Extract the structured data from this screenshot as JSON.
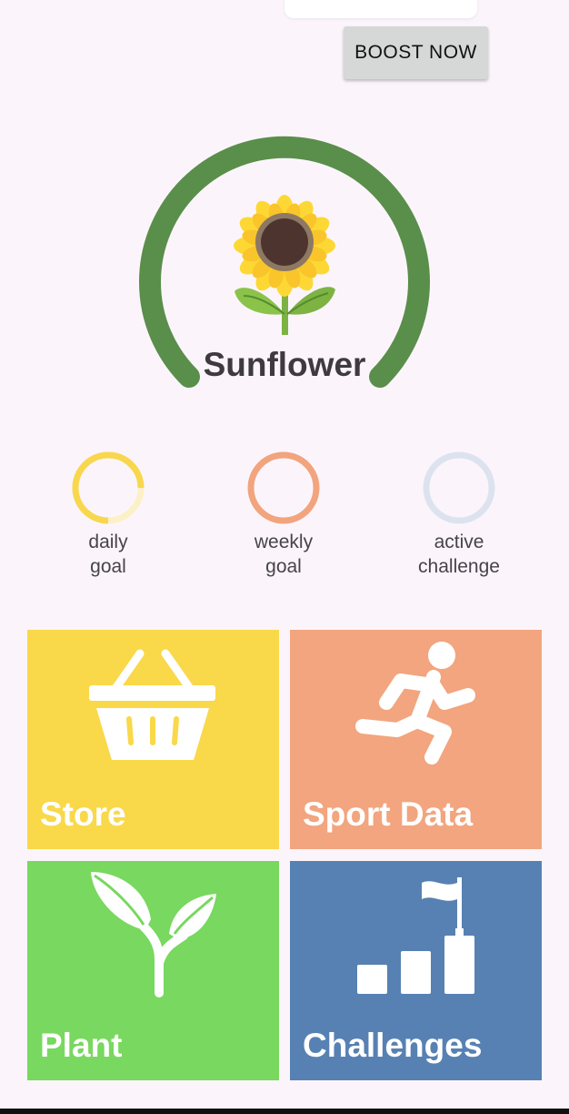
{
  "boost_button": {
    "label": "BOOST NOW"
  },
  "plant": {
    "name": "Sunflower",
    "icon": "sunflower-icon"
  },
  "goals": [
    {
      "label_line1": "daily",
      "label_line2": "goal",
      "color": "#F8D74E",
      "progress": 0.6
    },
    {
      "label_line1": "weekly",
      "label_line2": "goal",
      "color": "#F2A47E",
      "progress": 1.0
    },
    {
      "label_line1": "active",
      "label_line2": "challenge",
      "color": "#DCE3EF",
      "progress": 1.0
    }
  ],
  "tiles": [
    {
      "label": "Store",
      "color": "#F9D84A",
      "icon": "basket-icon"
    },
    {
      "label": "Sport Data",
      "color": "#F2A57E",
      "icon": "runner-icon"
    },
    {
      "label": "Plant",
      "color": "#78D85F",
      "icon": "sprout-icon"
    },
    {
      "label": "Challenges",
      "color": "#5781B3",
      "icon": "flag-steps-icon"
    }
  ],
  "colors": {
    "gauge": "#5A8E4B",
    "background": "#FBF5FB"
  }
}
